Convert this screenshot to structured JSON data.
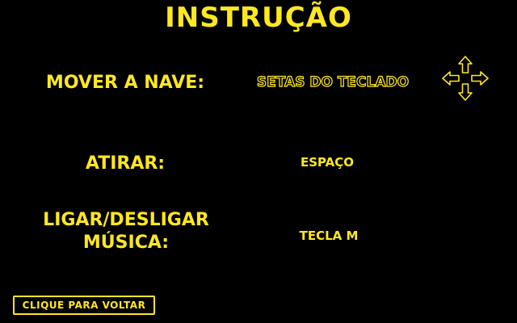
{
  "screen": {
    "title": "INSTRUÇÃO"
  },
  "controls": [
    {
      "label": "MOVER A NAVE:",
      "value": "SETAS DO TECLADO",
      "icon": "arrow-keys-icon"
    },
    {
      "label": "ATIRAR:",
      "value": "ESPAÇO"
    },
    {
      "label_line1": "LIGAR/DESLIGAR",
      "label_line2": "MÚSICA:",
      "value": "TECLA M"
    }
  ],
  "back_button": {
    "label": "CLIQUE PARA VOLTAR"
  },
  "colors": {
    "background": "#000000",
    "accent": "#FFE81F"
  }
}
